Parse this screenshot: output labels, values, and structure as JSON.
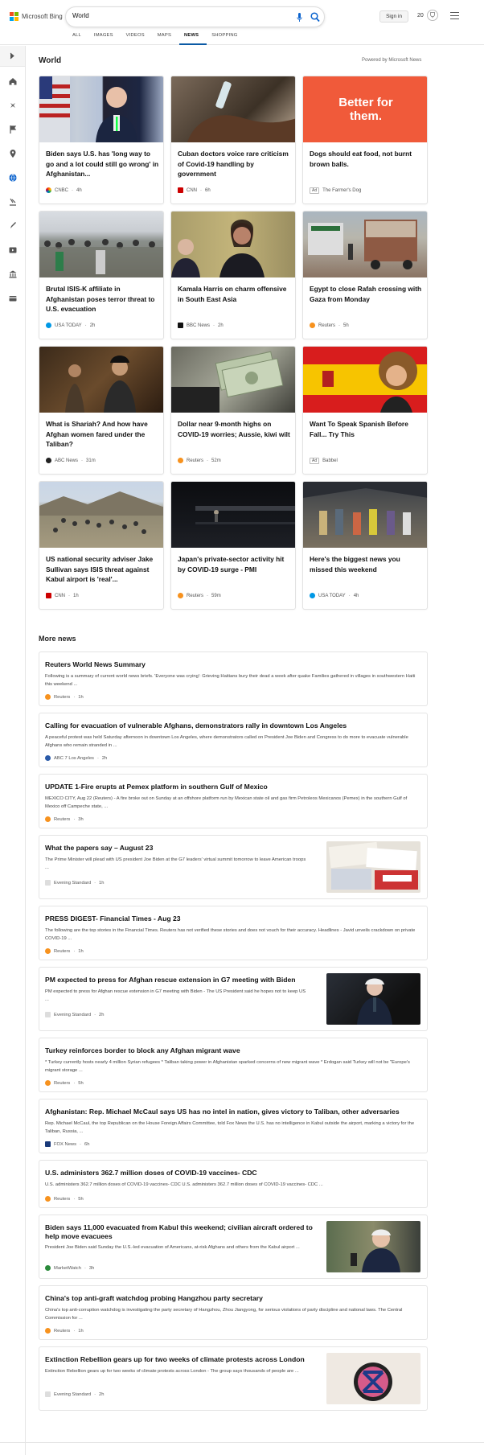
{
  "header": {
    "brand": "Microsoft Bing",
    "search_value": "World",
    "signin": "Sign in",
    "rewards_count": "20",
    "brand_colors": [
      "#f25022",
      "#7fba00",
      "#00a4ef",
      "#ffb900"
    ],
    "tabs": [
      {
        "label": "ALL",
        "active": false
      },
      {
        "label": "IMAGES",
        "active": false
      },
      {
        "label": "VIDEOS",
        "active": false
      },
      {
        "label": "MAPS",
        "active": false
      },
      {
        "label": "NEWS",
        "active": true
      },
      {
        "label": "SHOPPING",
        "active": false
      }
    ]
  },
  "sidebar": {
    "icons": [
      "chevron-right-icon",
      "home-icon",
      "discover-icon",
      "flag-icon",
      "location-pin-icon",
      "globe-icon",
      "science-icon",
      "rocket-icon",
      "video-icon",
      "bank-icon",
      "card-icon"
    ]
  },
  "world": {
    "title": "World",
    "powered": "Powered by Microsoft News",
    "cards": [
      {
        "title": "Biden says U.S. has 'long way to go and a lot could still go wrong' in Afghanistan...",
        "source": "CNBC",
        "time": "4h"
      },
      {
        "title": "Cuban doctors voice rare criticism of Covid-19 handling by government",
        "source": "CNN",
        "time": "6h"
      },
      {
        "title": "Dogs should eat food, not burnt brown balls.",
        "source": "The Farmer's Dog",
        "ad": "Ad",
        "promo_text": "Better for them."
      },
      {
        "title": "Brutal ISIS-K affiliate in Afghanistan poses terror threat to U.S. evacuation",
        "source": "USA TODAY",
        "time": "2h"
      },
      {
        "title": "Kamala Harris on charm offensive in South East Asia",
        "source": "BBC News",
        "time": "2h"
      },
      {
        "title": "Egypt to close Rafah crossing with Gaza from Monday",
        "source": "Reuters",
        "time": "5h"
      },
      {
        "title": "What is Shariah? And how have Afghan women fared under the Taliban?",
        "source": "ABC News",
        "time": "31m"
      },
      {
        "title": "Dollar near 9-month highs on COVID-19 worries; Aussie, kiwi wilt",
        "source": "Reuters",
        "time": "52m"
      },
      {
        "title": "Want To Speak Spanish Before Fall... Try This",
        "source": "Babbel",
        "ad": "Ad"
      },
      {
        "title": "US national security adviser Jake Sullivan says ISIS threat against Kabul airport is 'real'...",
        "source": "CNN",
        "time": "1h"
      },
      {
        "title": "Japan's private-sector activity hit by COVID-19 surge - PMI",
        "source": "Reuters",
        "time": "59m"
      },
      {
        "title": "Here's the biggest news you missed this weekend",
        "source": "USA TODAY",
        "time": "4h"
      }
    ]
  },
  "more_news": {
    "title": "More news",
    "items": [
      {
        "title": "Reuters World News Summary",
        "snippet": "Following is a summary of current world news briefs. 'Everyone was crying': Grieving Haitians bury their dead a week after quake Families gathered in villages in southwestern Haiti this weekend ...",
        "source": "Reuters",
        "time": "1h"
      },
      {
        "title": "Calling for evacuation of vulnerable Afghans, demonstrators rally in downtown Los Angeles",
        "snippet": "A peaceful protest was held Saturday afternoon in downtown Los Angeles, where demonstrators called on President Joe Biden and Congress to do more to evacuate vulnerable Afghans who remain stranded in ...",
        "source": "ABC 7 Los Angeles",
        "time": "2h"
      },
      {
        "title": "UPDATE 1-Fire erupts at Pemex platform in southern Gulf of Mexico",
        "snippet": "MEXICO CITY, Aug 22 (Reuters) - A fire broke out on Sunday at an offshore platform run by Mexican state oil and gas firm Petroleos Mexicanos (Pemex) in the southern Gulf of Mexico off Campeche state, ...",
        "source": "Reuters",
        "time": "3h"
      },
      {
        "title": "What the papers say – August 23",
        "snippet": "The Prime Minister will plead with US president Joe Biden at the G7 leaders' virtual summit tomorrow to leave American troops ...",
        "source": "Evening Standard",
        "time": "1h",
        "thumb": "papers"
      },
      {
        "title": "PRESS DIGEST- Financial Times - Aug 23",
        "snippet": "The following are the top stories in the Financial Times. Reuters has not verified these stories and does not vouch for their accuracy. Headlines - Javid unveils crackdown on private COVID-19 ...",
        "source": "Reuters",
        "time": "1h"
      },
      {
        "title": "PM expected to press for Afghan rescue extension in G7 meeting with Biden",
        "snippet": "PM expected to press for Afghan rescue extension in G7 meeting with Biden - The US President said he hopes not to keep US ...",
        "source": "Evening Standard",
        "time": "2h",
        "thumb": "pm"
      },
      {
        "title": "Turkey reinforces border to block any Afghan migrant wave",
        "snippet": "* Turkey currently hosts nearly 4 million Syrian refugees * Taliban taking power in Afghanistan sparked concerns of new migrant wave * Erdogan said Turkey will not be \"Europe's migrant storage ...",
        "source": "Reuters",
        "time": "5h"
      },
      {
        "title": "Afghanistan: Rep. Michael McCaul says US has no intel in nation, gives victory to Taliban, other adversaries",
        "snippet": "Rep. Michael McCaul, the top Republican on the House Foreign Affairs Committee, told Fox News the U.S. has no intelligence in Kabul outside the airport, marking a victory for the Taliban, Russia, ...",
        "source": "FOX News",
        "time": "6h"
      },
      {
        "title": "U.S. administers 362.7 million doses of COVID-19 vaccines- CDC",
        "snippet": "U.S. administers 362.7 million doses of COVID-19 vaccines- CDC U.S. administers 362.7 million doses of COVID-19 vaccines- CDC ...",
        "source": "Reuters",
        "time": "5h"
      },
      {
        "title": "Biden says 11,000 evacuated from Kabul this weekend; civilian aircraft ordered to help move evacuees",
        "snippet": "President Joe Biden said Sunday the U.S.-led evacuation of Americans, at-risk Afghans and others from the Kabul airport ...",
        "source": "MarketWatch",
        "time": "3h",
        "thumb": "biden"
      },
      {
        "title": "China's top anti-graft watchdog probing Hangzhou party secretary",
        "snippet": "China's top anti-corruption watchdog is investigating the party secretary of Hangzhou, Zhou Jiangyong, for serious violations of party discipline and national laws. The Central Commission for ...",
        "source": "Reuters",
        "time": "1h"
      },
      {
        "title": "Extinction Rebellion gears up for two weeks of climate protests across London",
        "snippet": "Extinction Rebellion gears up for two weeks of climate protests across London - The group says thousands of people are ...",
        "source": "Evening Standard",
        "time": "2h",
        "thumb": "xr"
      }
    ]
  }
}
